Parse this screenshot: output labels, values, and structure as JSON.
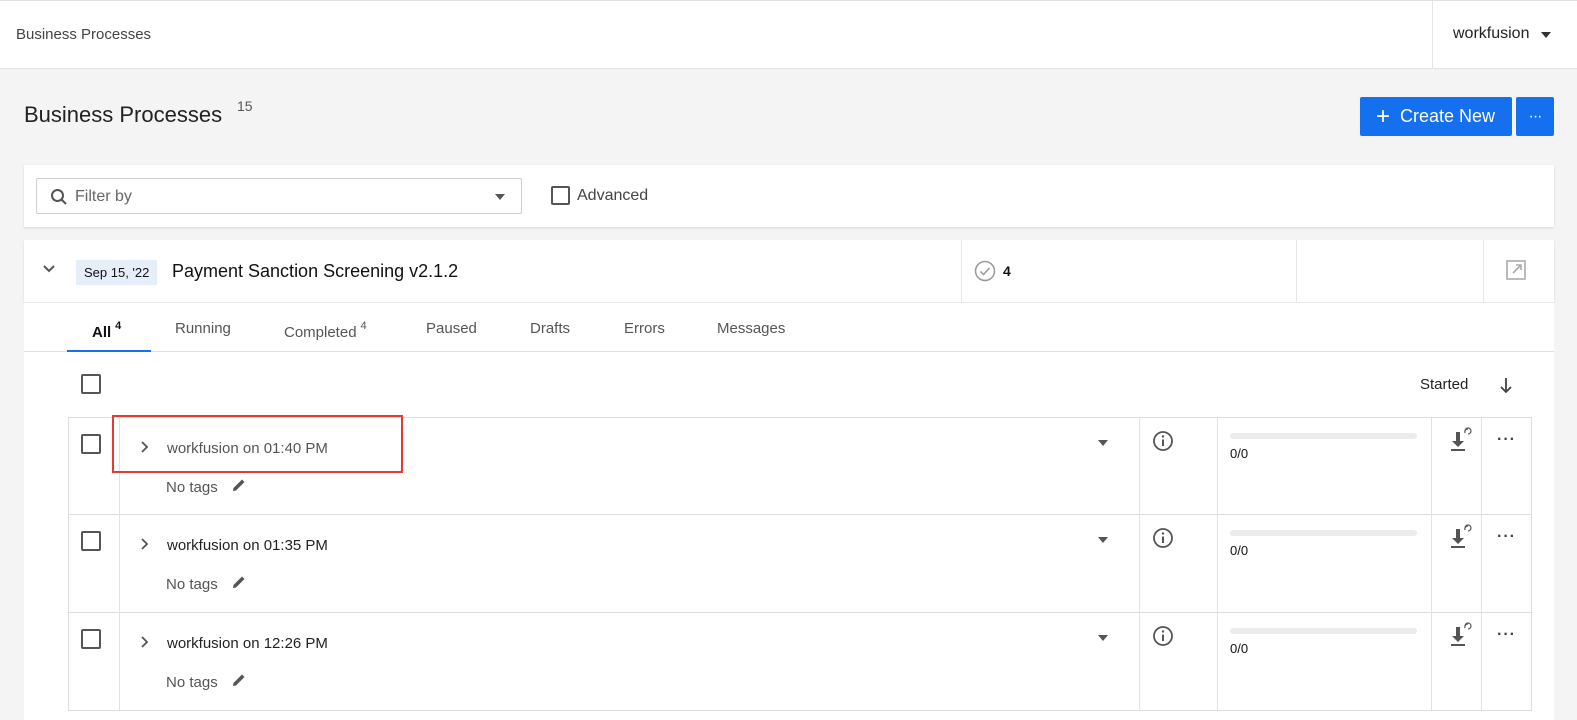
{
  "topbar": {
    "breadcrumb": "Business Processes",
    "user": "workfusion"
  },
  "page": {
    "title": "Business Processes",
    "count": "15",
    "create_label": "Create New",
    "more_label": "···"
  },
  "filter": {
    "placeholder": "Filter by",
    "advanced_label": "Advanced",
    "advanced_checked": false
  },
  "process": {
    "date": "Sep 15, '22",
    "name": "Payment Sanction Screening v2.1.2",
    "completed_count": "4"
  },
  "tabs": [
    {
      "label": "All",
      "count": "4",
      "active": true
    },
    {
      "label": "Running",
      "count": ""
    },
    {
      "label": "Completed",
      "count": "4"
    },
    {
      "label": "Paused",
      "count": ""
    },
    {
      "label": "Drafts",
      "count": ""
    },
    {
      "label": "Errors",
      "count": ""
    },
    {
      "label": "Messages",
      "count": ""
    }
  ],
  "list": {
    "sort_label": "Started",
    "rows": [
      {
        "title": "workfusion on  01:40 PM",
        "tags": "No tags",
        "progress_text": "0/0",
        "progress": 0
      },
      {
        "title": "workfusion on  01:35 PM",
        "tags": "No tags",
        "progress_text": "0/0",
        "progress": 0
      },
      {
        "title": "workfusion on  12:26 PM",
        "tags": "No tags",
        "progress_text": "0/0",
        "progress": 0
      }
    ]
  },
  "colors": {
    "accent": "#1570ef",
    "highlight": "#e53935"
  }
}
